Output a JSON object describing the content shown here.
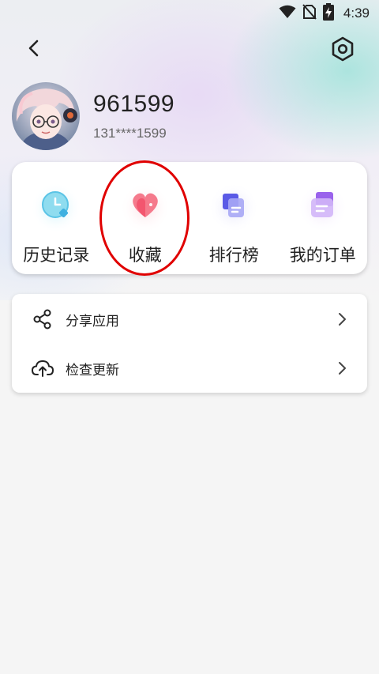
{
  "status_bar": {
    "time": "4:39",
    "icons": [
      "wifi-icon",
      "no-sim-icon",
      "battery-charging-icon"
    ]
  },
  "header": {
    "back_icon": "chevron-left-icon",
    "settings_icon": "hexagon-settings-icon"
  },
  "profile": {
    "username": "961599",
    "phone": "131****1599",
    "avatar": "anime-avatar"
  },
  "features": [
    {
      "label": "历史记录",
      "icon": "history-icon",
      "color": "#4fc3e8"
    },
    {
      "label": "收藏",
      "icon": "heart-icon",
      "color": "#f2506a"
    },
    {
      "label": "排行榜",
      "icon": "ranking-icon",
      "color": "#7c7cf0"
    },
    {
      "label": "我的订单",
      "icon": "order-icon",
      "color": "#a679f0"
    }
  ],
  "highlight_color": "#e00000",
  "menu": [
    {
      "label": "分享应用",
      "icon": "share-icon",
      "chevron": "chevron-right-icon"
    },
    {
      "label": "检查更新",
      "icon": "cloud-upload-icon",
      "chevron": "chevron-right-icon"
    }
  ]
}
